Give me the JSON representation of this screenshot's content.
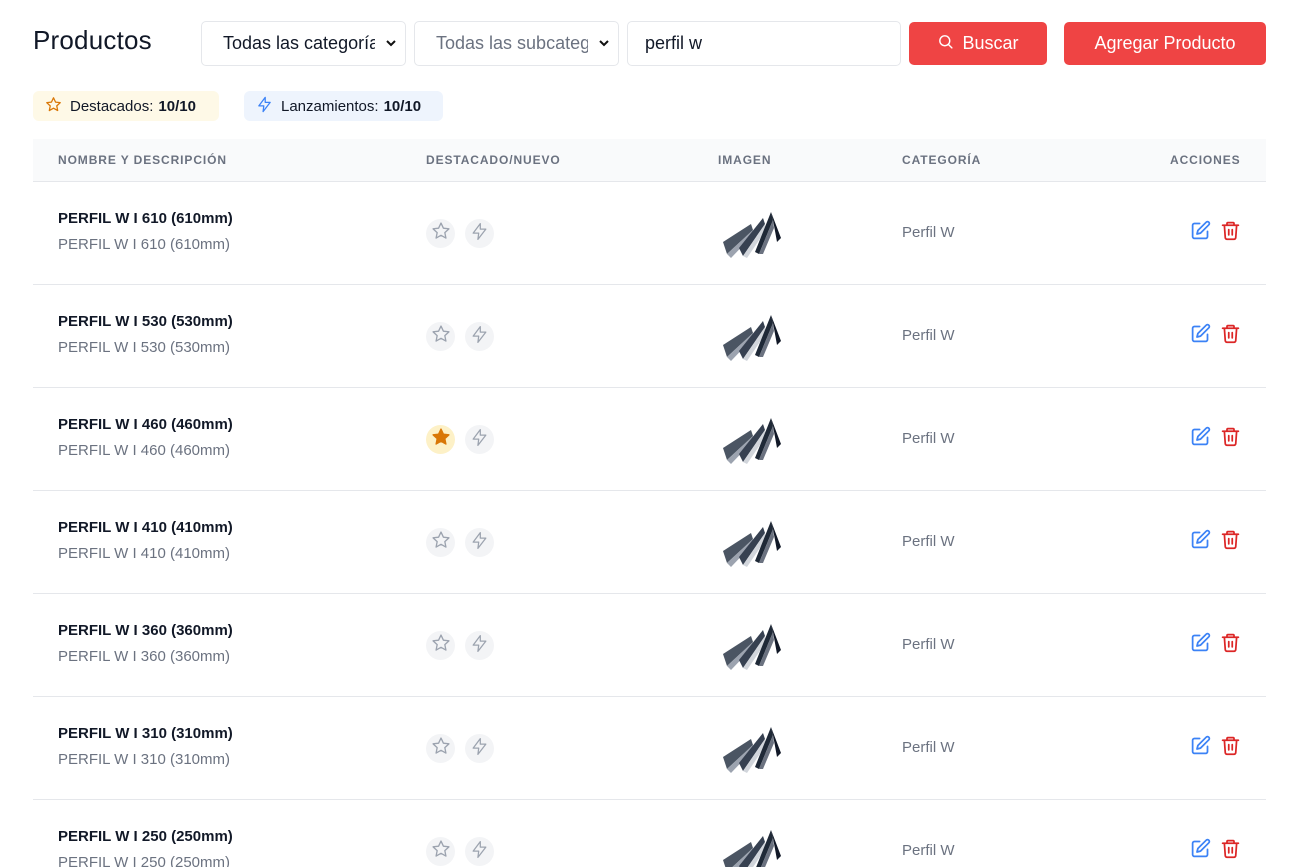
{
  "header": {
    "title": "Productos",
    "category_select": "Todas las categorías",
    "subcategory_select": "Todas las subcategorías",
    "search_value": "perfil w",
    "search_button": "Buscar",
    "add_button": "Agregar Producto"
  },
  "chips": {
    "featured_label": "Destacados:",
    "featured_count": "10/10",
    "launches_label": "Lanzamientos:",
    "launches_count": "10/10"
  },
  "table": {
    "columns": [
      "NOMBRE Y DESCRIPCIÓN",
      "DESTACADO/NUEVO",
      "IMAGEN",
      "CATEGORÍA",
      "ACCIONES"
    ],
    "rows": [
      {
        "name": "PERFIL W I 610 (610mm)",
        "description": "PERFIL W I 610 (610mm)",
        "category": "Perfil W",
        "featured": false,
        "new": false
      },
      {
        "name": "PERFIL W I 530 (530mm)",
        "description": "PERFIL W I 530 (530mm)",
        "category": "Perfil W",
        "featured": false,
        "new": false
      },
      {
        "name": "PERFIL W I 460 (460mm)",
        "description": "PERFIL W I 460 (460mm)",
        "category": "Perfil W",
        "featured": true,
        "new": false
      },
      {
        "name": "PERFIL W I 410 (410mm)",
        "description": "PERFIL W I 410 (410mm)",
        "category": "Perfil W",
        "featured": false,
        "new": false
      },
      {
        "name": "PERFIL W I 360 (360mm)",
        "description": "PERFIL W I 360 (360mm)",
        "category": "Perfil W",
        "featured": false,
        "new": false
      },
      {
        "name": "PERFIL W I 310 (310mm)",
        "description": "PERFIL W I 310 (310mm)",
        "category": "Perfil W",
        "featured": false,
        "new": false
      },
      {
        "name": "PERFIL W I 250 (250mm)",
        "description": "PERFIL W I 250 (250mm)",
        "category": "Perfil W",
        "featured": false,
        "new": false
      }
    ]
  },
  "colors": {
    "accent": "#ef4444",
    "edit_icon": "#3b82f6",
    "delete_icon": "#dc2626",
    "star_active": "#d97706"
  },
  "icons": {
    "search": "search-icon",
    "star": "star-icon",
    "bolt": "bolt-icon",
    "edit": "edit-icon",
    "delete": "trash-icon",
    "chevron": "chevron-down-icon"
  }
}
